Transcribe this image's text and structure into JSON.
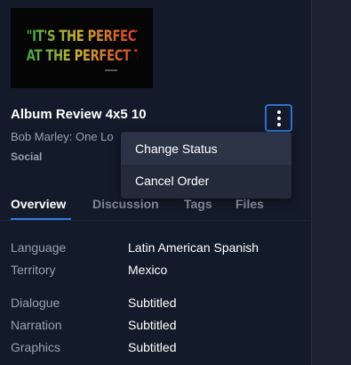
{
  "asset": {
    "thumbnail_line1": "\"IT'S THE PERFECT MOVIE",
    "thumbnail_line2": "AT THE PERFECT TIME\"",
    "title": "Album Review 4x5 10",
    "subtitle": "Bob Marley: One Lo",
    "category": "Social"
  },
  "menu": {
    "items": [
      {
        "label": "Change Status"
      },
      {
        "label": "Cancel Order"
      }
    ]
  },
  "tabs": [
    {
      "label": "Overview",
      "active": true
    },
    {
      "label": "Discussion",
      "active": false
    },
    {
      "label": "Tags",
      "active": false
    },
    {
      "label": "Files",
      "active": false
    }
  ],
  "details": [
    {
      "label": "Language",
      "value": "Latin American Spanish"
    },
    {
      "label": "Territory",
      "value": "Mexico"
    },
    {
      "label": "Dialogue",
      "value": "Subtitled"
    },
    {
      "label": "Narration",
      "value": "Subtitled"
    },
    {
      "label": "Graphics",
      "value": "Subtitled"
    }
  ],
  "colors": {
    "accent": "#2f7be0",
    "background": "#131a29",
    "menu_background": "#232b3b",
    "muted_text": "#9aa1ad"
  }
}
